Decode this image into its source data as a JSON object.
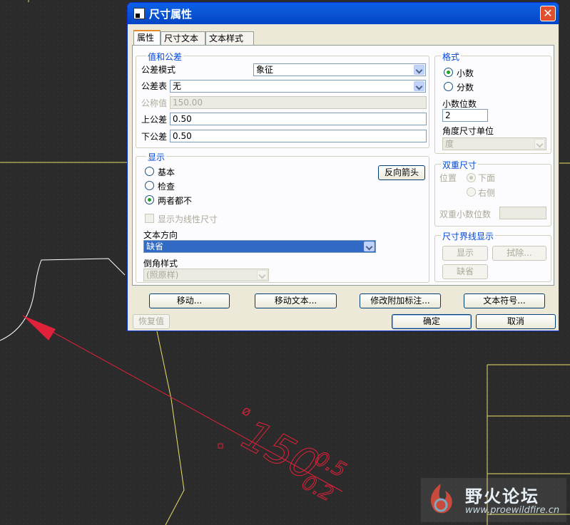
{
  "dialog": {
    "title": "尺寸属性",
    "close_glyph": "✕",
    "tabs": [
      {
        "label": "属性",
        "active": true
      },
      {
        "label": "尺寸文本",
        "active": false
      },
      {
        "label": "文本样式",
        "active": false
      }
    ]
  },
  "value_tolerance": {
    "title": "值和公差",
    "tolerance_mode_label": "公差模式",
    "tolerance_mode_value": "象征",
    "tolerance_table_label": "公差表",
    "tolerance_table_value": "无",
    "nominal_label": "公称值",
    "nominal_value": "150.00",
    "upper_label": "上公差",
    "upper_value": "0.50",
    "lower_label": "下公差",
    "lower_value": "0.50"
  },
  "format": {
    "title": "格式",
    "decimal_label": "小数",
    "fraction_label": "分数",
    "decimal_places_label": "小数位数",
    "decimal_places_value": "2",
    "angle_unit_label": "角度尺寸单位",
    "angle_unit_value": "度"
  },
  "display": {
    "title": "显示",
    "basic_label": "基本",
    "inspect_label": "检查",
    "neither_label": "两者都不",
    "flip_arrows_label": "反向箭头",
    "show_linear_label": "显示为线性尺寸",
    "text_orientation_label": "文本方向",
    "text_orientation_value": "缺省",
    "chamfer_label": "倒角样式",
    "chamfer_value": "(照原样)"
  },
  "dual": {
    "title": "双重尺寸",
    "position_label": "位置",
    "below_label": "下面",
    "right_label": "右侧",
    "dual_decimal_label": "双重小数位数"
  },
  "witness": {
    "title": "尺寸界线显示",
    "show_label": "显示",
    "erase_label": "拭除...",
    "default_label": "缺省"
  },
  "actions": {
    "move": "移动...",
    "move_text": "移动文本...",
    "edit_attach": "修改附加标注...",
    "text_symbol": "文本符号..."
  },
  "footer": {
    "restore": "恢复值",
    "ok": "确定",
    "cancel": "取消"
  },
  "drawing": {
    "dim_main": "150",
    "dim_upper": "0.5",
    "dim_lower": "0.2",
    "dim_prefix": "Ø",
    "colors": {
      "dim": "#e0213a",
      "geometry": "#e8e06a",
      "arc": "#ffffff"
    }
  },
  "watermark": {
    "title": "野火论坛",
    "url": "www.proewildfire.cn"
  }
}
